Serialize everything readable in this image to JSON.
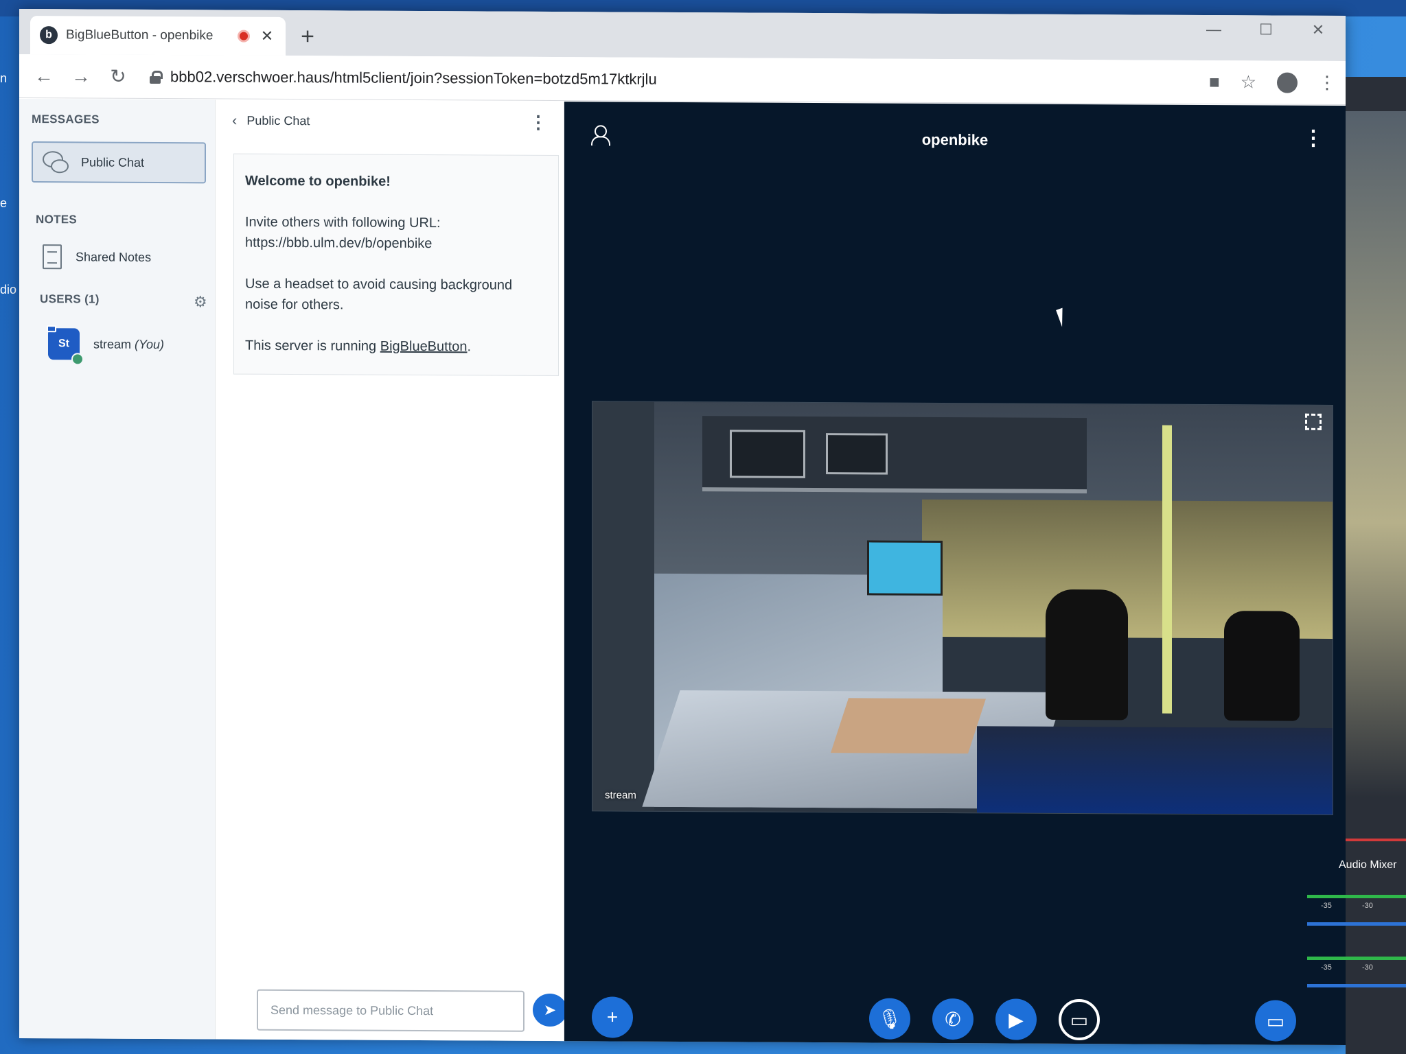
{
  "desktop": {
    "left_labels": [
      "n",
      "e",
      "dio"
    ]
  },
  "browser": {
    "tab": {
      "title": "BigBlueButton - openbike",
      "favicon_letter": "b"
    },
    "new_tab_glyph": "+",
    "url": "bbb02.verschwoer.haus/html5client/join?sessionToken=botzd5m17ktkrjlu",
    "nav": {
      "back": "←",
      "forward": "→",
      "reload": "↻"
    },
    "toolbar_icons": [
      "camera-icon",
      "star-icon",
      "profile-icon",
      "menu-icon"
    ],
    "window_controls": {
      "minimize": "—",
      "maximize": "☐",
      "close": "✕"
    }
  },
  "sidebar": {
    "messages_title": "MESSAGES",
    "public_chat_label": "Public Chat",
    "notes_title": "NOTES",
    "shared_notes_label": "Shared Notes",
    "users_title": "USERS (1)",
    "users": [
      {
        "initials": "St",
        "name": "stream",
        "tag": "(You)"
      }
    ]
  },
  "chat": {
    "title": "Public Chat",
    "welcome": {
      "title": "Welcome to openbike!",
      "invite_line": "Invite others with following URL:",
      "invite_url": "https://bbb.ulm.dev/b/openbike",
      "headset_line": "Use a headset to avoid causing background noise for others.",
      "server_prefix": "This server is running ",
      "server_link": "BigBlueButton",
      "server_suffix": "."
    },
    "input_placeholder": "Send message to Public Chat"
  },
  "main": {
    "meeting_name": "openbike",
    "video_label": "stream"
  },
  "obs": {
    "audio_mixer_label": "Audio Mixer",
    "meter_ticks": [
      "-35",
      "-30"
    ]
  },
  "colors": {
    "accent": "#1d6fd8",
    "main_bg": "#06172a",
    "sidebar_bg": "#f3f6f9",
    "desktop_bg": "#2b7fd6"
  }
}
